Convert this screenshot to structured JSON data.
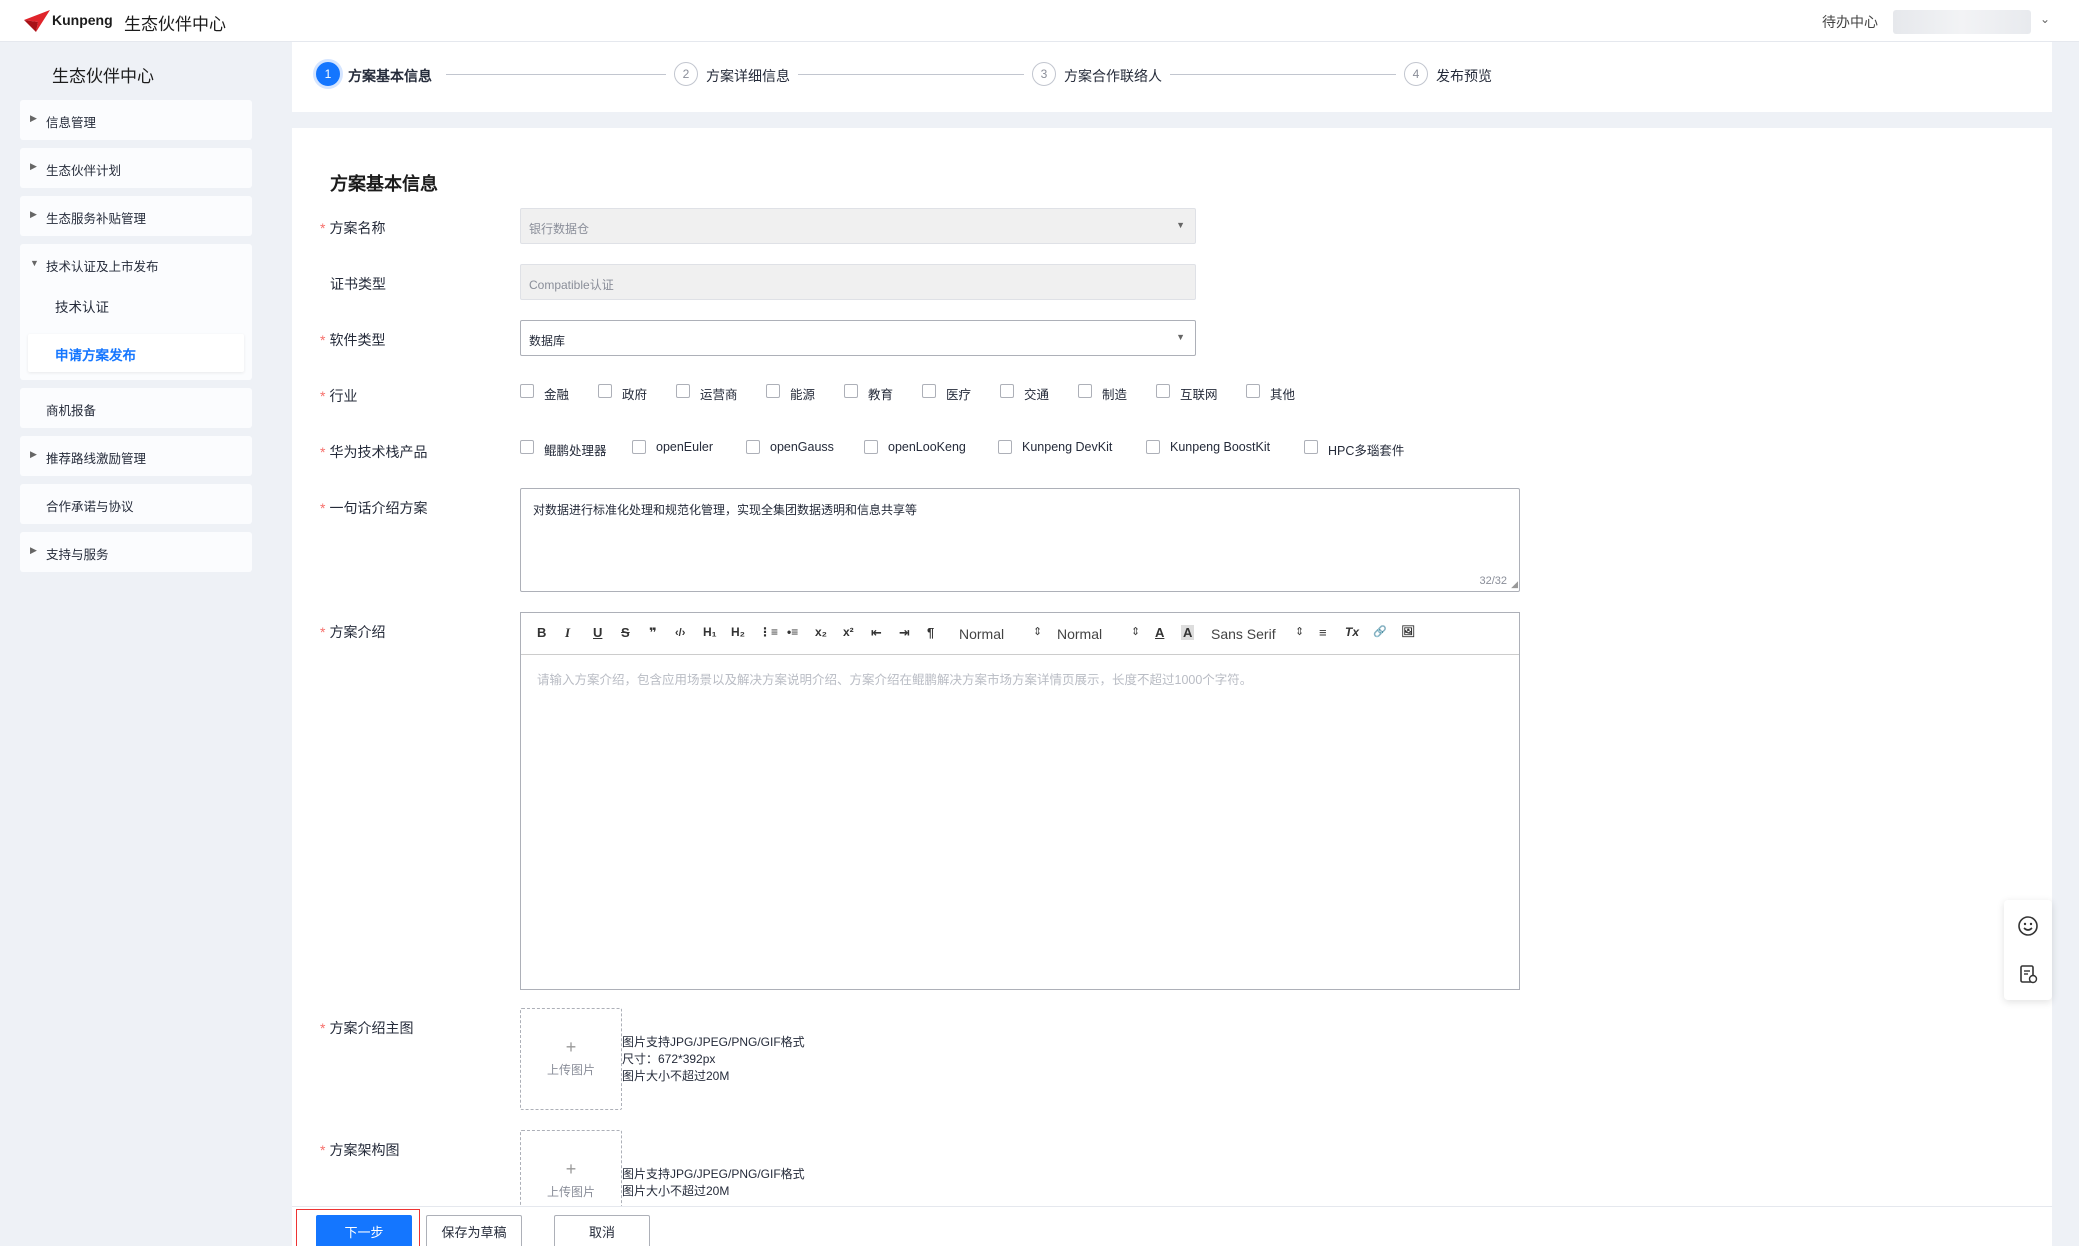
{
  "header": {
    "brand": "Kunpeng",
    "portal_title": "生态伙伴中心",
    "todo_label": "待办中心",
    "user_caret": "⌄"
  },
  "sidebar": {
    "title": "生态伙伴中心",
    "items": [
      {
        "label": "信息管理",
        "arrow": "▶"
      },
      {
        "label": "生态伙伴计划",
        "arrow": "▶"
      },
      {
        "label": "生态服务补贴管理",
        "arrow": "▶"
      },
      {
        "label": "技术认证及上市发布",
        "arrow": "▼"
      },
      {
        "label": "商机报备",
        "arrow": ""
      },
      {
        "label": "推荐路线激励管理",
        "arrow": "▶"
      },
      {
        "label": "合作承诺与协议",
        "arrow": ""
      },
      {
        "label": "支持与服务",
        "arrow": "▶"
      }
    ],
    "sub_items": [
      {
        "label": "技术认证"
      },
      {
        "label": "申请方案发布"
      }
    ]
  },
  "steps": [
    {
      "num": "1",
      "label": "方案基本信息"
    },
    {
      "num": "2",
      "label": "方案详细信息"
    },
    {
      "num": "3",
      "label": "方案合作联络人"
    },
    {
      "num": "4",
      "label": "发布预览"
    }
  ],
  "form": {
    "section_title": "方案基本信息",
    "required_mark": "*",
    "caret": "▼",
    "name": {
      "label": "方案名称",
      "value": "银行数据仓"
    },
    "cert_type": {
      "label": "证书类型",
      "value": "Compatible认证"
    },
    "software_type": {
      "label": "软件类型",
      "value": "数据库"
    },
    "industry": {
      "label": "行业",
      "options": [
        "金融",
        "政府",
        "运营商",
        "能源",
        "教育",
        "医疗",
        "交通",
        "制造",
        "互联网",
        "其他"
      ]
    },
    "tech_stack": {
      "label": "华为技术栈产品",
      "options": [
        "鲲鹏处理器",
        "openEuler",
        "openGauss",
        "openLooKeng",
        "Kunpeng DevKit",
        "Kunpeng BoostKit",
        "HPC多瑙套件"
      ]
    },
    "one_line": {
      "label": "一句话介绍方案",
      "value": "对数据进行标准化处理和规范化管理，实现全集团数据透明和信息共享等",
      "counter": "32/32",
      "resize": "◢"
    },
    "intro": {
      "label": "方案介绍",
      "placeholder": "请输入方案介绍，包含应用场景以及解决方案说明介绍、方案介绍在鲲鹏解决方案市场方案详情页展示，长度不超过1000个字符。",
      "toolbar": {
        "bold": "B",
        "italic": "I",
        "underline": "U",
        "strike": "S",
        "quote": "❞",
        "code": "‹/›",
        "h1": "H₁",
        "h2": "H₂",
        "ol": "⋮≡",
        "ul": "•≡",
        "sub": "x₂",
        "sup": "x²",
        "outdent": "⇤",
        "indent": "⇥",
        "rtl": "¶",
        "size": "Normal",
        "header": "Normal",
        "color": "A",
        "background": "A",
        "font": "Sans Serif",
        "align": "≡",
        "clean": "Tx",
        "link": "🔗",
        "image": "🖼",
        "dd": "⇕"
      }
    },
    "main_image": {
      "label": "方案介绍主图",
      "upload_plus": "+",
      "upload_text": "上传图片",
      "hints": [
        "图片支持JPG/JPEG/PNG/GIF格式",
        "尺寸：672*392px",
        "图片大小不超过20M"
      ]
    },
    "arch_image": {
      "label": "方案架构图",
      "upload_plus": "+",
      "upload_text": "上传图片",
      "hints": [
        "图片支持JPG/JPEG/PNG/GIF格式",
        "图片大小不超过20M"
      ]
    }
  },
  "actions": {
    "next": "下一步",
    "save_draft": "保存为草稿",
    "cancel": "取消"
  },
  "colors": {
    "primary": "#1476ff",
    "required": "#f66f6a",
    "focus_outline": "#ee3333"
  }
}
